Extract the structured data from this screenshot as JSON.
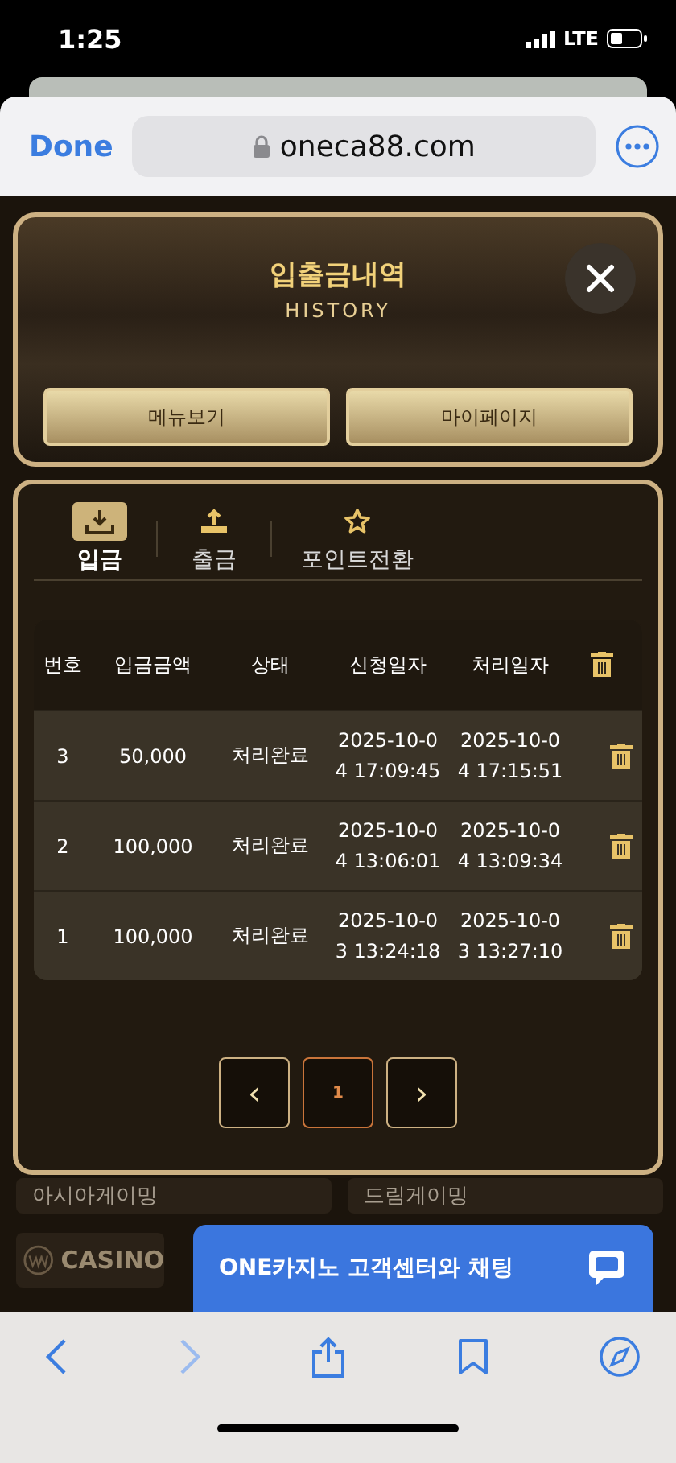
{
  "status_bar": {
    "time": "1:25",
    "network": "LTE"
  },
  "browser": {
    "done": "Done",
    "url": "oneca88.com",
    "forward_disabled": true
  },
  "header": {
    "title": "입출금내역",
    "subtitle": "HISTORY",
    "buttons": [
      "메뉴보기",
      "마이페이지"
    ]
  },
  "tabs": [
    {
      "label": "입금",
      "kind": "deposit",
      "selected": true
    },
    {
      "label": "출금",
      "kind": "withdraw",
      "selected": false
    },
    {
      "label": "포인트전환",
      "kind": "points",
      "selected": false
    }
  ],
  "table": {
    "columns": [
      "번호",
      "입금금액",
      "상태",
      "신청일자",
      "처리일자"
    ],
    "rows": [
      {
        "no": "3",
        "amount": "50,000",
        "status": "처리완료",
        "requested": [
          "2025-10-0",
          "4 17:09:45"
        ],
        "processed": [
          "2025-10-0",
          "4 17:15:51"
        ]
      },
      {
        "no": "2",
        "amount": "100,000",
        "status": "처리완료",
        "requested": [
          "2025-10-0",
          "4 13:06:01"
        ],
        "processed": [
          "2025-10-0",
          "4 13:09:34"
        ]
      },
      {
        "no": "1",
        "amount": "100,000",
        "status": "처리완료",
        "requested": [
          "2025-10-0",
          "3 13:24:18"
        ],
        "processed": [
          "2025-10-0",
          "3 13:27:10"
        ]
      }
    ]
  },
  "pagination": {
    "prev": "‹",
    "pages": [
      {
        "label": "1",
        "selected": true
      }
    ],
    "next": "›"
  },
  "background_tiles": [
    "아시아게이밍",
    "드림게이밍",
    "CASINO"
  ],
  "chat": {
    "label": "ONE카지노 고객센터와 채팅"
  }
}
